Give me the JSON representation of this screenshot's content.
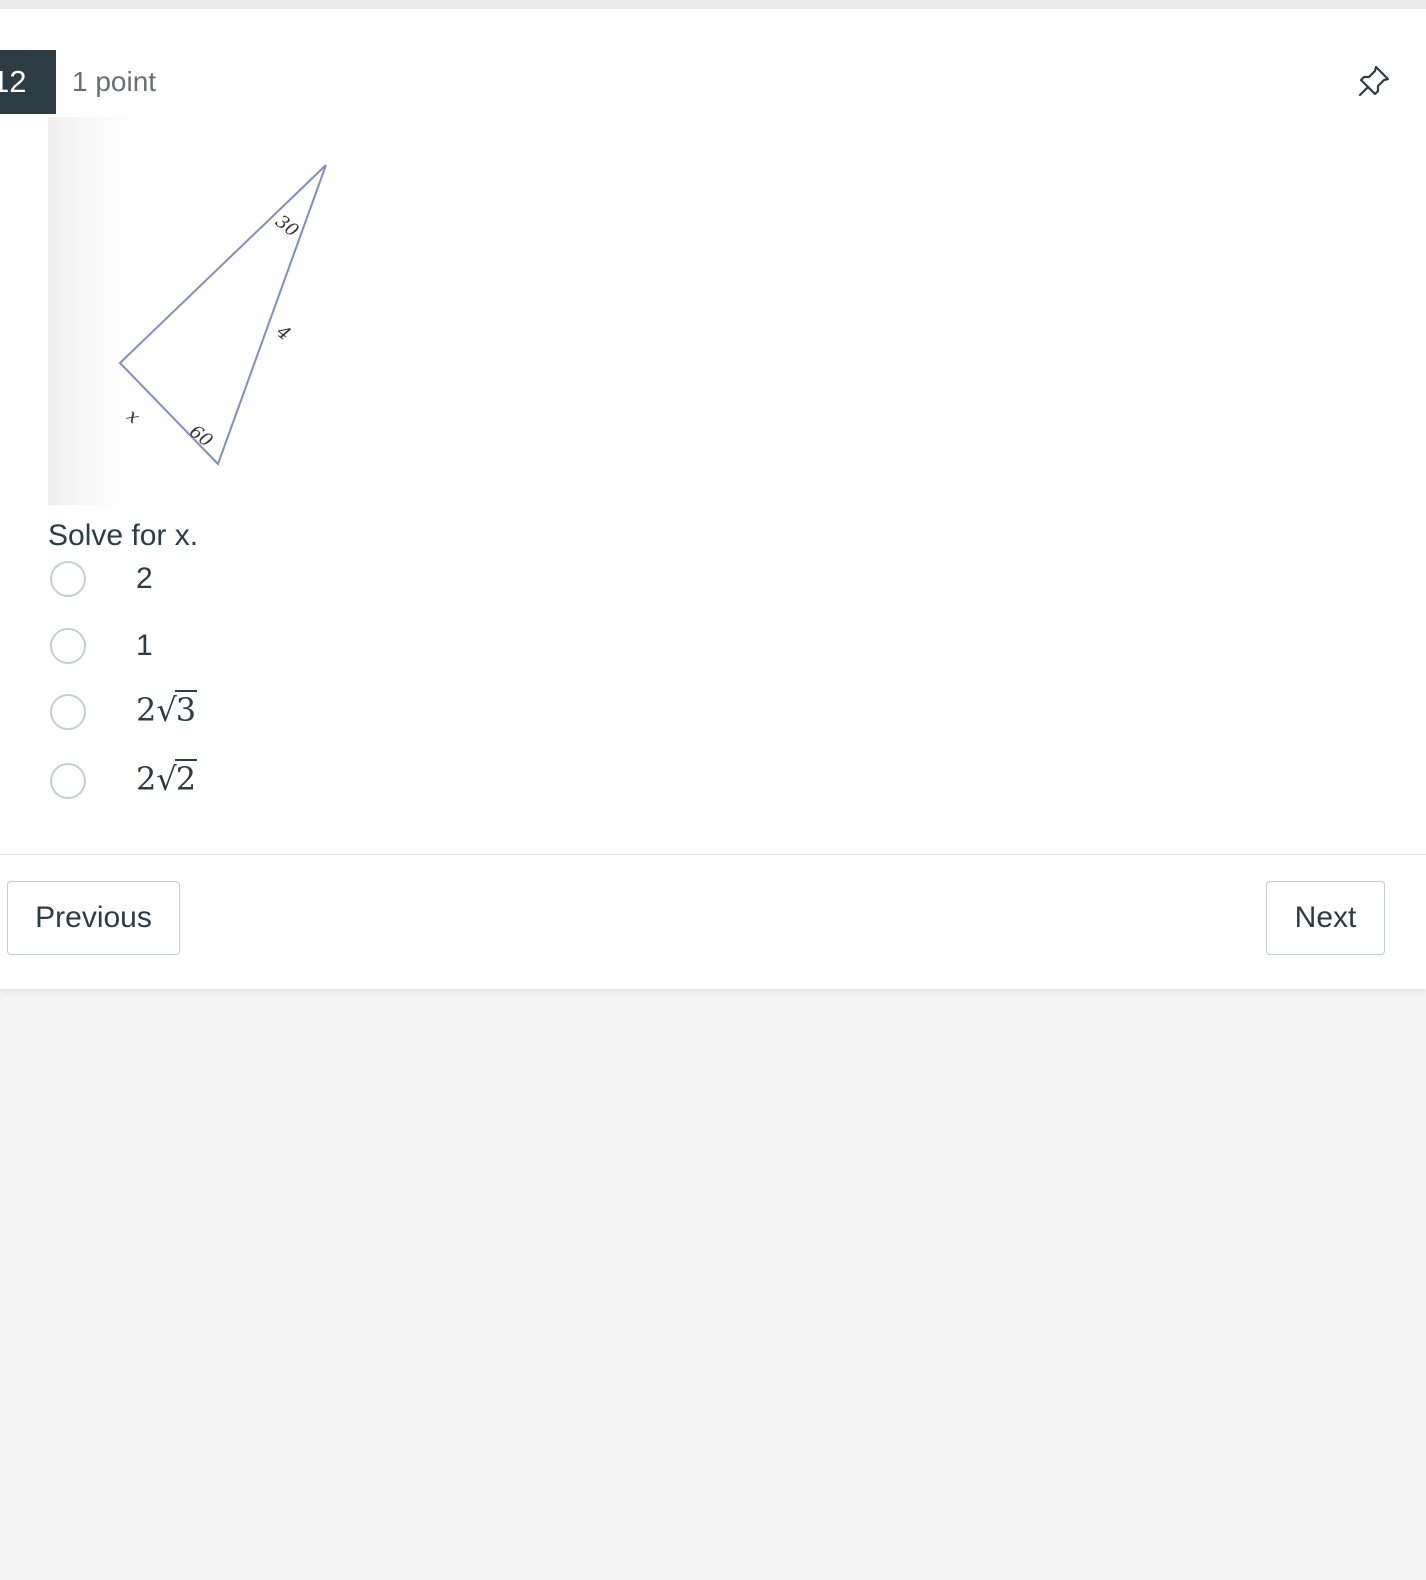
{
  "question": {
    "number": "12",
    "points": "1 point",
    "prompt": "Solve for x."
  },
  "figure": {
    "angle_top": "30",
    "side_right": "4",
    "side_left": "x",
    "angle_bottom": "60"
  },
  "answers": [
    {
      "text": "2",
      "math": false
    },
    {
      "text": "1",
      "math": false
    },
    {
      "text": "2√3",
      "math": true,
      "coef": "2",
      "radical": "√",
      "radicand": "3"
    },
    {
      "text": "2√2",
      "math": true,
      "coef": "2",
      "radical": "√",
      "radicand": "2"
    }
  ],
  "navigation": {
    "previous_label": "Previous",
    "next_label": "Next"
  },
  "icons": {
    "pin": "pin-icon"
  },
  "colors": {
    "badge_bg": "#2d3b45",
    "text": "#2d3b45",
    "muted_text": "#6b6f73",
    "triangle_stroke": "#7f8fc0",
    "page_bg": "#f4f4f4"
  }
}
